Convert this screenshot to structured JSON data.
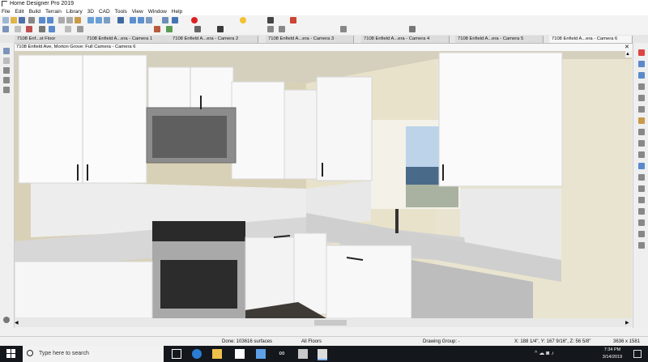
{
  "app": {
    "title": "Home Designer Pro 2019"
  },
  "menu": [
    "File",
    "Edit",
    "Build",
    "Terrain",
    "Library",
    "3D",
    "CAD",
    "Tools",
    "View",
    "Window",
    "Help"
  ],
  "tabs": [
    "7108 Enf...st Floor",
    "7108 Enfield A...era - Camera 1",
    "7108 Enfield A...era - Camera 2",
    "7108 Enfield A...era - Camera 3",
    "7108 Enfield A...era - Camera 4",
    "7108 Enfield A...era - Camera 5",
    "7108 Enfield A...era - Camera 6"
  ],
  "view": {
    "title": "7108 Enfield Ave, Morton Grove: Full Camera - Camera 6"
  },
  "status": {
    "done": "Done:  103616 surfaces",
    "floors": "All Floors",
    "drawing_group": "Drawing Group: -",
    "coords": "X: 188 1/4\", Y: 167 9/16\", Z: 56 5/8\"",
    "dims": "3636 x 1581"
  },
  "taskbar": {
    "search_placeholder": "Type here to search",
    "time": "7:34 PM",
    "date": "3/14/2019"
  }
}
